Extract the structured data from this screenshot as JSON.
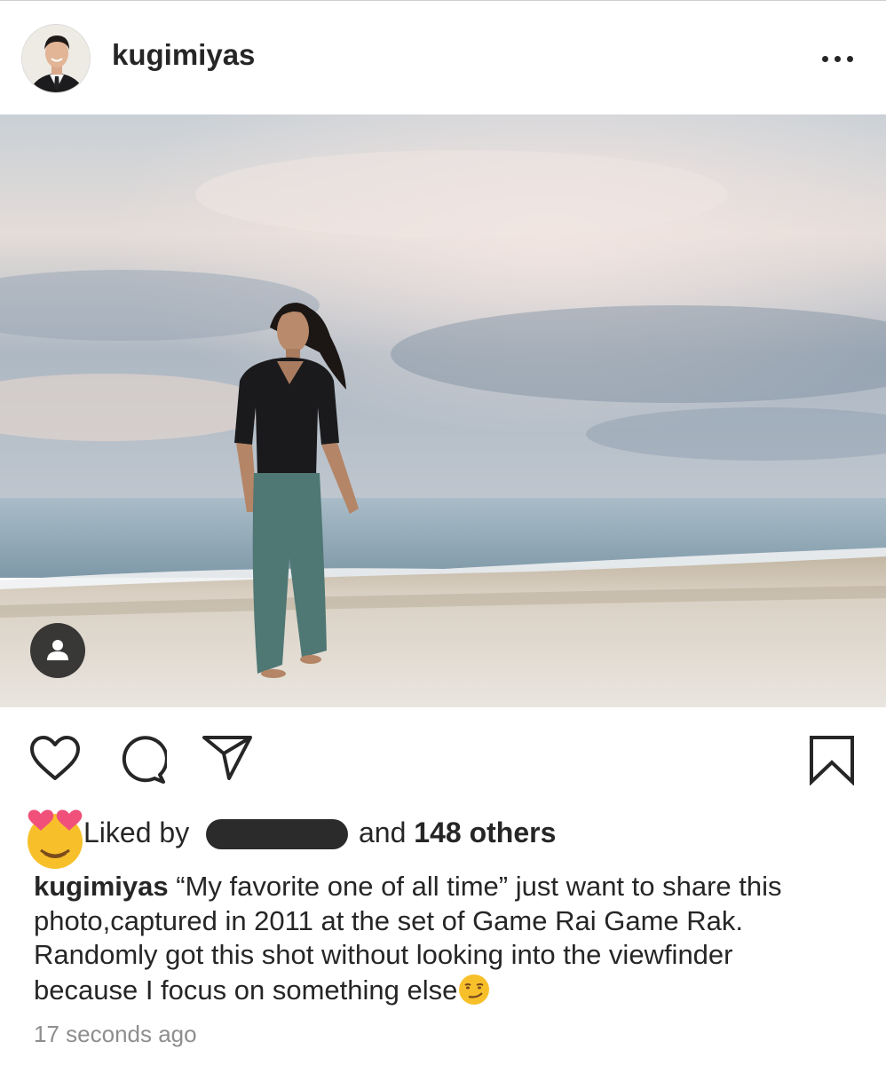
{
  "post": {
    "username": "kugimiyas",
    "liked_by_label": "Liked by",
    "likes_suffix_prefix": "and",
    "likes_count_text": "148 others",
    "caption_text": "“My favorite one of all time” just want to share this photo,captured in 2011 at the set of Game Rai Game Rak. Randomly got this shot without looking into the viewfinder because I focus on something else",
    "timestamp": "17 seconds ago"
  },
  "icons": {
    "more": "more-options-icon",
    "tag": "user-tag-icon",
    "like": "heart-icon",
    "comment": "comment-icon",
    "share": "share-icon",
    "save": "bookmark-icon",
    "liked_emoji": "heart-eyes-emoji",
    "caption_emoji": "smirking-face-emoji"
  },
  "colors": {
    "text": "#262626",
    "muted": "#8e8e8e",
    "emoji_yellow": "#f7c02b",
    "heart_pink": "#f0507a"
  }
}
